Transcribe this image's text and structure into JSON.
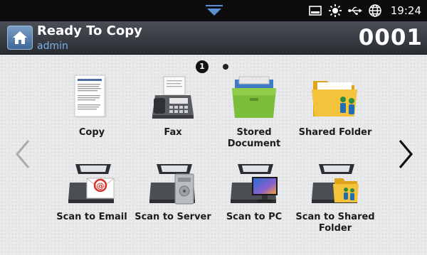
{
  "status_bar": {
    "time": "19:24",
    "icons": [
      "pull-down-handle-icon",
      "tray-icon",
      "brightness-icon",
      "usb-icon",
      "globe-icon"
    ]
  },
  "header": {
    "title": "Ready To Copy",
    "user": "admin",
    "count": "0001"
  },
  "pager": {
    "current_page": "1",
    "total_pages": 2
  },
  "apps": [
    {
      "label": "Copy",
      "icon": "copy-document-icon"
    },
    {
      "label": "Fax",
      "icon": "fax-machine-icon"
    },
    {
      "label": "Stored Document",
      "icon": "stored-document-folder-icon"
    },
    {
      "label": "Shared Folder",
      "icon": "shared-folder-icon"
    },
    {
      "label": "Scan to Email",
      "icon": "scan-to-email-icon"
    },
    {
      "label": "Scan to Server",
      "icon": "scan-to-server-icon"
    },
    {
      "label": "Scan to PC",
      "icon": "scan-to-pc-icon"
    },
    {
      "label": "Scan to Shared Folder",
      "icon": "scan-to-shared-folder-icon"
    }
  ],
  "colors": {
    "header_top": "#4a4f57",
    "subtitle": "#7fb2e6",
    "home_button": "#3f6796",
    "background": "#e9eaeb"
  }
}
